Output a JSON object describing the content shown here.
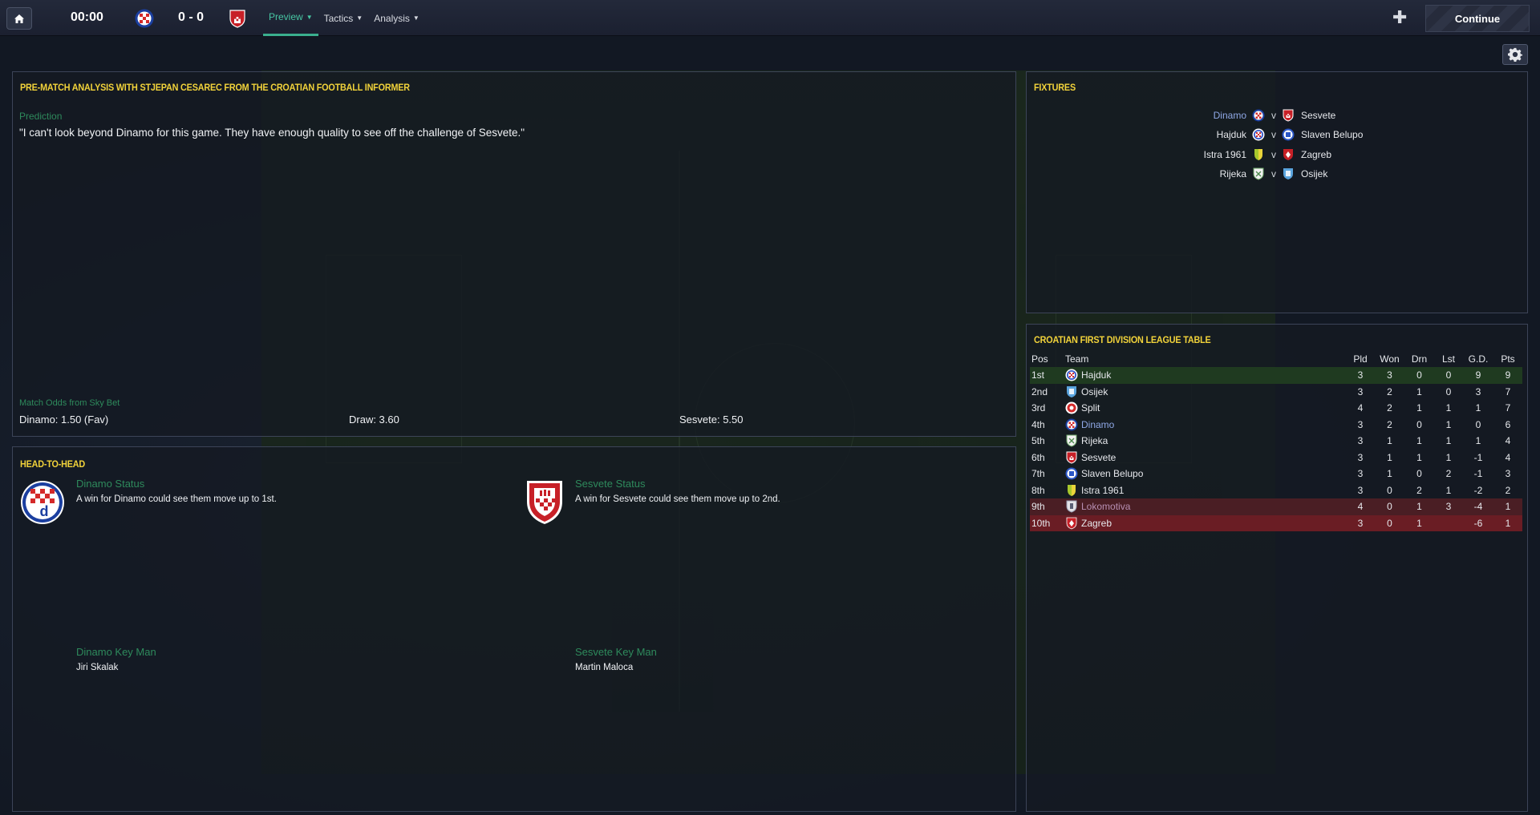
{
  "topbar": {
    "clock": "00:00",
    "score": "0 - 0",
    "nav": [
      {
        "label": "Preview",
        "active": true
      },
      {
        "label": "Tactics",
        "active": false
      },
      {
        "label": "Analysis",
        "active": false
      }
    ],
    "continue_label": "Continue"
  },
  "prematch": {
    "title": "PRE-MATCH ANALYSIS WITH STJEPAN CESAREC FROM THE CROATIAN FOOTBALL INFORMER",
    "prediction_label": "Prediction",
    "prediction_text": "\"I can't look beyond Dinamo for this game. They have enough quality to see off the challenge of Sesvete.\"",
    "odds_label": "Match Odds from Sky Bet",
    "odds_home": "Dinamo: 1.50 (Fav)",
    "odds_draw": "Draw: 3.60",
    "odds_away": "Sesvete: 5.50"
  },
  "h2h": {
    "title": "HEAD-TO-HEAD",
    "home_status_label": "Dinamo Status",
    "home_status_text": "A win for Dinamo could see them move up to 1st.",
    "away_status_label": "Sesvete Status",
    "away_status_text": "A win for Sesvete could see them move up to 2nd.",
    "home_keyman_label": "Dinamo Key Man",
    "home_keyman": "Jiri Skalak",
    "away_keyman_label": "Sesvete Key Man",
    "away_keyman": "Martin Maloca"
  },
  "fixtures": {
    "title": "FIXTURES",
    "items": [
      {
        "home": "Dinamo",
        "v": "v",
        "away": "Sesvete"
      },
      {
        "home": "Hajduk",
        "v": "v",
        "away": "Slaven Belupo"
      },
      {
        "home": "Istra 1961",
        "v": "v",
        "away": "Zagreb"
      },
      {
        "home": "Rijeka",
        "v": "v",
        "away": "Osijek"
      }
    ]
  },
  "league": {
    "title": "CROATIAN FIRST DIVISION LEAGUE TABLE",
    "headers": {
      "pos": "Pos",
      "team": "Team",
      "pld": "Pld",
      "won": "Won",
      "drn": "Drn",
      "lst": "Lst",
      "gd": "G.D.",
      "pts": "Pts"
    },
    "rows": [
      {
        "pos": "1st",
        "team": "Hajduk",
        "pld": "3",
        "won": "3",
        "drn": "0",
        "lst": "0",
        "gd": "9",
        "pts": "9"
      },
      {
        "pos": "2nd",
        "team": "Osijek",
        "pld": "3",
        "won": "2",
        "drn": "1",
        "lst": "0",
        "gd": "3",
        "pts": "7"
      },
      {
        "pos": "3rd",
        "team": "Split",
        "pld": "4",
        "won": "2",
        "drn": "1",
        "lst": "1",
        "gd": "1",
        "pts": "7"
      },
      {
        "pos": "4th",
        "team": "Dinamo",
        "pld": "3",
        "won": "2",
        "drn": "0",
        "lst": "1",
        "gd": "0",
        "pts": "6"
      },
      {
        "pos": "5th",
        "team": "Rijeka",
        "pld": "3",
        "won": "1",
        "drn": "1",
        "lst": "1",
        "gd": "1",
        "pts": "4"
      },
      {
        "pos": "6th",
        "team": "Sesvete",
        "pld": "3",
        "won": "1",
        "drn": "1",
        "lst": "1",
        "gd": "-1",
        "pts": "4"
      },
      {
        "pos": "7th",
        "team": "Slaven Belupo",
        "pld": "3",
        "won": "1",
        "drn": "0",
        "lst": "2",
        "gd": "-1",
        "pts": "3"
      },
      {
        "pos": "8th",
        "team": "Istra 1961",
        "pld": "3",
        "won": "0",
        "drn": "2",
        "lst": "1",
        "gd": "-2",
        "pts": "2"
      },
      {
        "pos": "9th",
        "team": "Lokomotiva",
        "pld": "4",
        "won": "0",
        "drn": "1",
        "lst": "3",
        "gd": "-4",
        "pts": "1"
      },
      {
        "pos": "10th",
        "team": "Zagreb",
        "pld": "3",
        "won": "0",
        "drn": "1",
        "lst": "",
        "gd": "-6",
        "pts": "1"
      }
    ]
  },
  "colors": {
    "accent_green": "#3aaf8e",
    "title_yellow": "#f2d33a",
    "label_green": "#2e8a5c",
    "highlight_blue": "#8fa8e6",
    "promotion_row": "#1f3a20",
    "relegation_row": "#6a1d24"
  }
}
